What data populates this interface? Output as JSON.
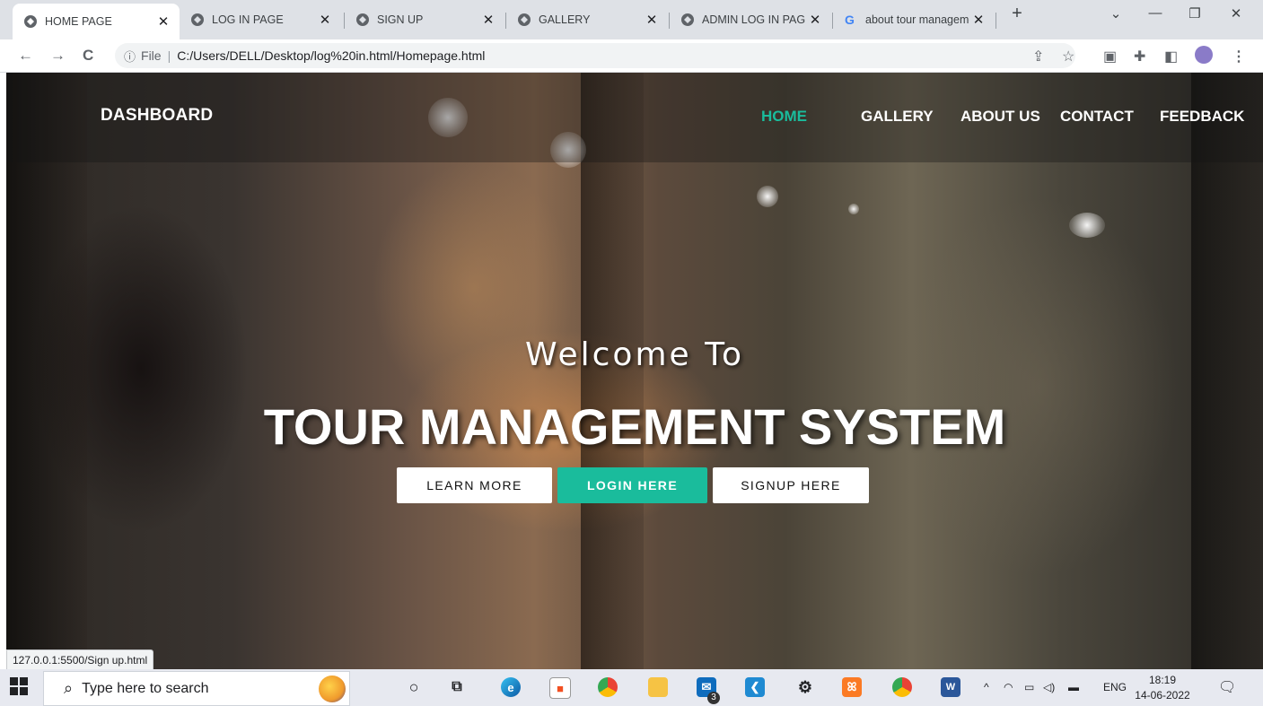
{
  "browser": {
    "tabs": [
      {
        "title": "HOME PAGE",
        "active": true
      },
      {
        "title": "LOG IN PAGE",
        "active": false
      },
      {
        "title": "SIGN UP",
        "active": false
      },
      {
        "title": "GALLERY",
        "active": false
      },
      {
        "title": "ADMIN LOG IN PAGE",
        "active": false
      },
      {
        "title": "about tour management",
        "active": false
      }
    ],
    "address": {
      "scheme_label": "File",
      "url": "C:/Users/DELL/Desktop/log%20in.html/Homepage.html"
    },
    "status_url": "127.0.0.1:5500/Sign up.html"
  },
  "page": {
    "brand": "DASHBOARD",
    "nav": [
      {
        "label": "HOME",
        "active": true
      },
      {
        "label": "GALLERY",
        "active": false
      },
      {
        "label": "ABOUT US",
        "active": false
      },
      {
        "label": "CONTACT",
        "active": false
      },
      {
        "label": "FEEDBACK",
        "active": false
      }
    ],
    "hero": {
      "welcome": "Welcome To",
      "title": "TOUR MANAGEMENT SYSTEM",
      "buttons": [
        "LEARN MORE",
        "LOGIN HERE",
        "SIGNUP HERE"
      ]
    },
    "colors": {
      "accent": "#1abc9c"
    }
  },
  "taskbar": {
    "search_placeholder": "Type here to search",
    "mail_badge": "3",
    "language": "ENG",
    "time": "18:19",
    "date": "14-06-2022",
    "apps": [
      "cortana-icon",
      "task-view-icon",
      "edge-icon",
      "store-icon",
      "chrome-icon",
      "file-explorer-icon",
      "mail-icon",
      "vscode-icon",
      "settings-icon",
      "xampp-icon",
      "chrome-profile-icon",
      "word-icon"
    ]
  }
}
